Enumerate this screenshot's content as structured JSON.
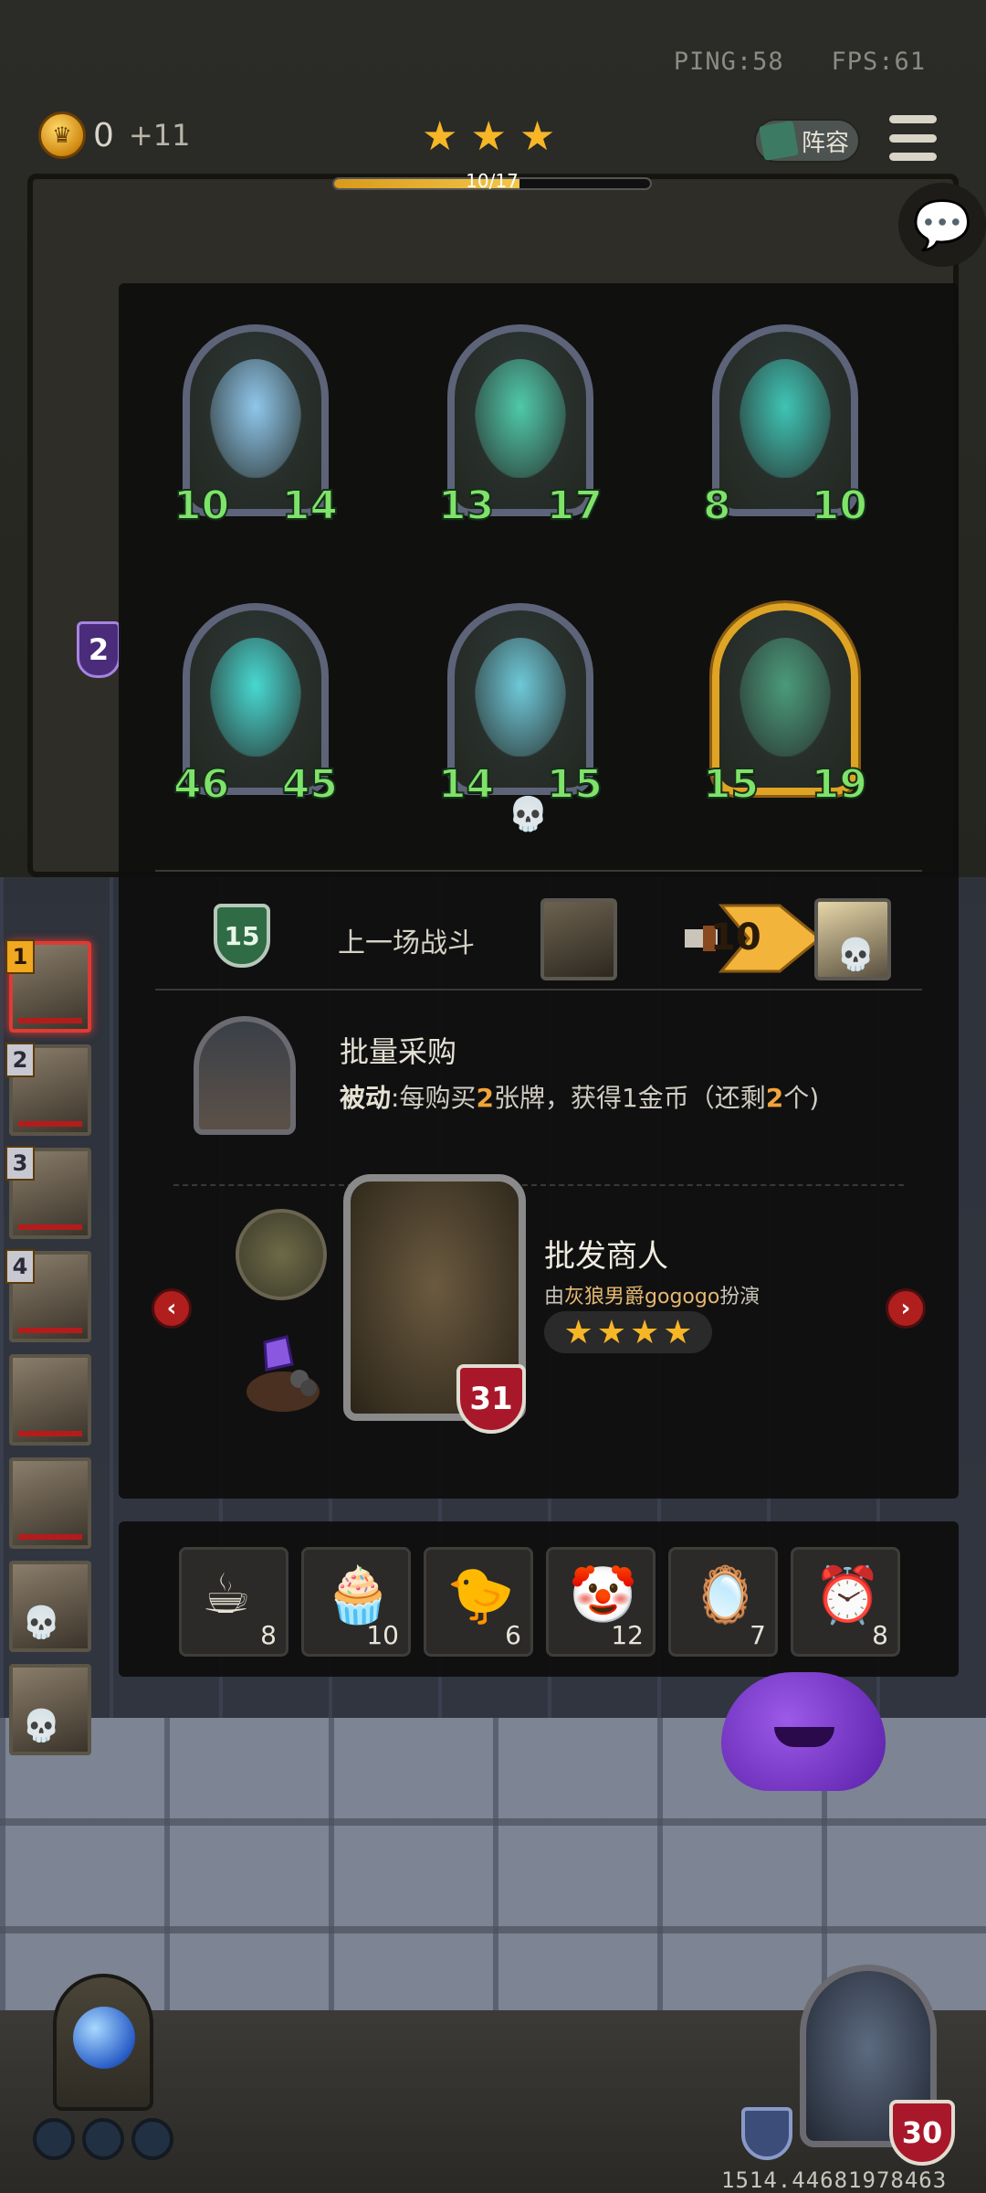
{
  "hud": {
    "ping": "PING:58",
    "fps": "FPS:61",
    "gold": "0",
    "gold_income": "+11",
    "tavern_stars": 3,
    "xp_text": "10/17",
    "xp_progress": 0.588,
    "lineup_label": "阵容"
  },
  "minions": [
    {
      "atk": "10",
      "hp": "14",
      "color": "#8fc6ea",
      "golden": false
    },
    {
      "atk": "13",
      "hp": "17",
      "color": "#4fc9a8",
      "golden": false
    },
    {
      "atk": "8",
      "hp": "10",
      "color": "#3ec4b4",
      "golden": false
    },
    {
      "atk": "46",
      "hp": "45",
      "color": "#47d8d0",
      "golden": false
    },
    {
      "atk": "14",
      "hp": "15",
      "color": "#6ec8d8",
      "golden": false,
      "dead": true
    },
    {
      "atk": "15",
      "hp": "19",
      "color": "#4a9a7a",
      "golden": true
    }
  ],
  "last_battle": {
    "tier": "15",
    "label": "上一场战斗",
    "damage": "10"
  },
  "ability": {
    "title": "批量采购",
    "desc_prefix": "被动",
    "desc_a": ":每购买",
    "desc_num1": "2",
    "desc_b": "张牌，获得1金币（还剩",
    "desc_num2": "2",
    "desc_c": "个)"
  },
  "hero": {
    "name": "批发商人",
    "sub_prefix": "由",
    "cast": "灰狼男爵gogogo",
    "sub_suffix": "扮演",
    "stars": 4,
    "hp": "31"
  },
  "items": [
    {
      "icon": "teacup-icon",
      "glyph": "☕",
      "count": "8"
    },
    {
      "icon": "cupcake-icon",
      "glyph": "🧁",
      "count": "10"
    },
    {
      "icon": "chicken-icon",
      "glyph": "🐤",
      "count": "6"
    },
    {
      "icon": "clown-icon",
      "glyph": "🤡",
      "count": "12"
    },
    {
      "icon": "mirror-icon",
      "glyph": "🪞",
      "count": "7"
    },
    {
      "icon": "alarm-clock-icon",
      "glyph": "⏰",
      "count": "8"
    }
  ],
  "players": [
    {
      "rank": "1",
      "active": true,
      "dead": false
    },
    {
      "rank": "2",
      "active": false,
      "dead": false
    },
    {
      "rank": "3",
      "active": false,
      "dead": false
    },
    {
      "rank": "4",
      "active": false,
      "dead": false
    },
    {
      "rank": "",
      "active": false,
      "dead": false
    },
    {
      "rank": "",
      "active": false,
      "dead": false
    },
    {
      "rank": "",
      "active": false,
      "dead": true
    },
    {
      "rank": "",
      "active": false,
      "dead": true
    }
  ],
  "player_badge": "2",
  "my_hero_hp": "30",
  "coords": "1514.44681978463",
  "colors": {
    "gold_star": "#f6b626",
    "stat_green": "#7fe36a",
    "hp_red": "#a8182a",
    "accent_orange": "#f0a43a"
  }
}
